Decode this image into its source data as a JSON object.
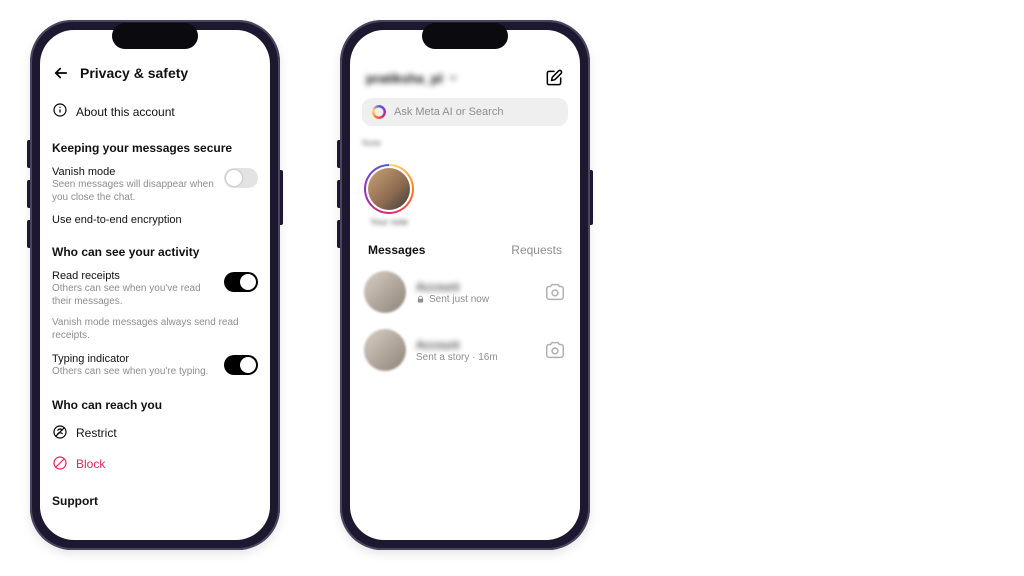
{
  "phone1": {
    "header": {
      "title": "Privacy & safety"
    },
    "about": "About this account",
    "sections": {
      "secure": {
        "title": "Keeping your messages secure",
        "vanish": {
          "label": "Vanish mode",
          "sub": "Seen messages will disappear when you close the chat.",
          "on": false
        },
        "e2ee": "Use end-to-end encryption"
      },
      "activity": {
        "title": "Who can see your activity",
        "read": {
          "label": "Read receipts",
          "sub": "Others can see when you've read their messages.",
          "on": true
        },
        "footnote": "Vanish mode messages always send read receipts.",
        "typing": {
          "label": "Typing indicator",
          "sub": "Others can see when you're typing.",
          "on": true
        }
      },
      "reach": {
        "title": "Who can reach you",
        "restrict": "Restrict",
        "block": "Block"
      },
      "support": {
        "title": "Support"
      }
    }
  },
  "phone2": {
    "username": "pratiksha_pl",
    "search_placeholder": "Ask Meta AI or Search",
    "story_section_label": "Note",
    "story_caption": "Your note",
    "tabs": {
      "messages": "Messages",
      "requests": "Requests"
    },
    "chats": [
      {
        "name": "Account",
        "meta": "Sent just now",
        "locked": true
      },
      {
        "name": "Account",
        "meta": "Sent a story · 16m",
        "locked": false
      }
    ]
  }
}
